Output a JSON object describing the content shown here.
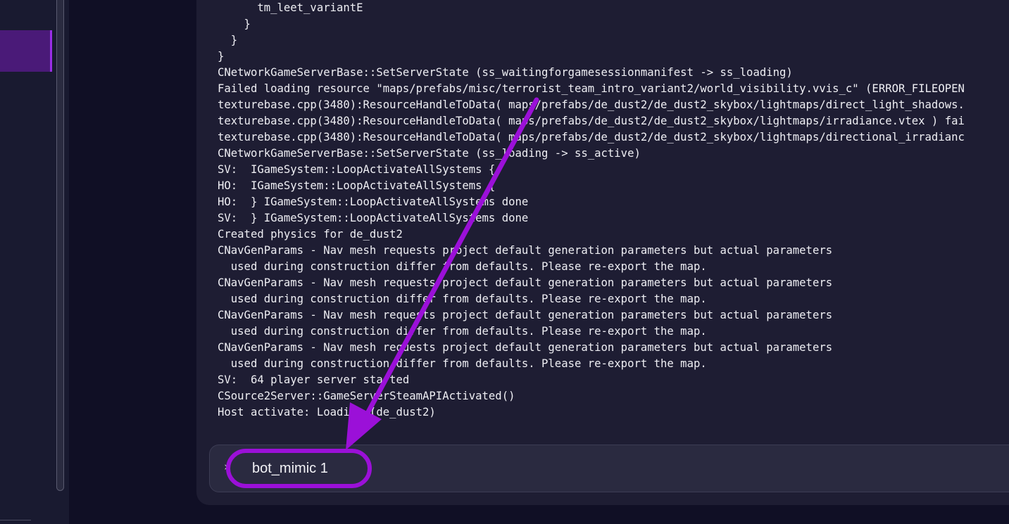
{
  "console": {
    "lines": [
      "      tm_leet_variantE",
      "    }",
      "  }",
      "}",
      "CNetworkGameServerBase::SetServerState (ss_waitingforgamesessionmanifest -> ss_loading)",
      "Failed loading resource \"maps/prefabs/misc/terrorist_team_intro_variant2/world_visibility.vvis_c\" (ERROR_FILEOPEN",
      "texturebase.cpp(3480):ResourceHandleToData( maps/prefabs/de_dust2/de_dust2_skybox/lightmaps/direct_light_shadows.",
      "texturebase.cpp(3480):ResourceHandleToData( maps/prefabs/de_dust2/de_dust2_skybox/lightmaps/irradiance.vtex ) fai",
      "texturebase.cpp(3480):ResourceHandleToData( maps/prefabs/de_dust2/de_dust2_skybox/lightmaps/directional_irradianc",
      "CNetworkGameServerBase::SetServerState (ss_loading -> ss_active)",
      "SV:  IGameSystem::LoopActivateAllSystems {",
      "HO:  IGameSystem::LoopActivateAllSystems {",
      "HO:  } IGameSystem::LoopActivateAllSystems done",
      "SV:  } IGameSystem::LoopActivateAllSystems done",
      "Created physics for de_dust2",
      "CNavGenParams - Nav mesh requests project default generation parameters but actual parameters",
      "  used during construction differ from defaults. Please re-export the map.",
      "CNavGenParams - Nav mesh requests project default generation parameters but actual parameters",
      "  used during construction differ from defaults. Please re-export the map.",
      "CNavGenParams - Nav mesh requests project default generation parameters but actual parameters",
      "  used during construction differ from defaults. Please re-export the map.",
      "CNavGenParams - Nav mesh requests project default generation parameters but actual parameters",
      "  used during construction differ from defaults. Please re-export the map.",
      "SV:  64 player server started",
      "CSource2Server::GameServerSteamAPIActivated()",
      "Host activate: Loading (de_dust2)"
    ]
  },
  "input": {
    "prompt_icon": "chevron-right-icon",
    "prompt_glyph": "›",
    "value": "bot_mimic 1"
  },
  "colors": {
    "background": "#100f25",
    "panel": "#1e1d33",
    "input_bar": "#2a2a40",
    "sidebar_active": "#4a1a78",
    "annotation": "#9b10d8"
  }
}
